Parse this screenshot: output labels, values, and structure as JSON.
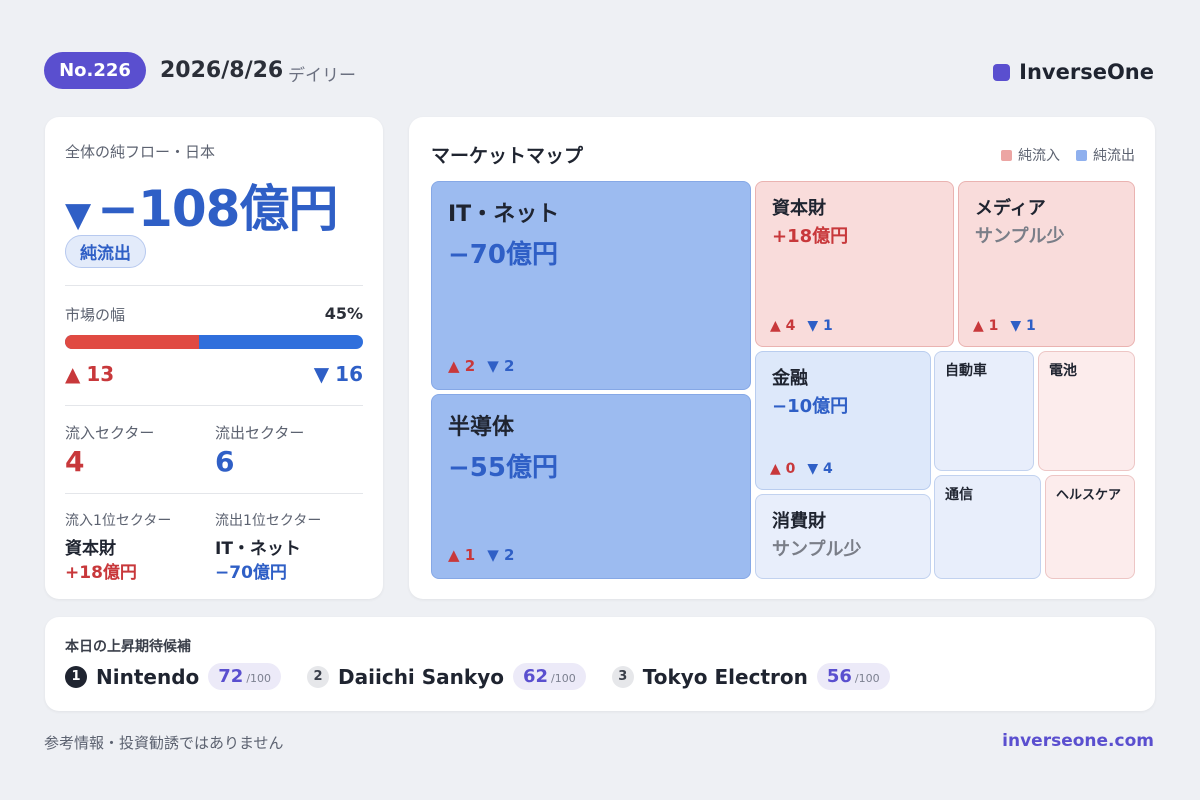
{
  "header": {
    "issue_badge": "No.226",
    "date": "2026/8/26",
    "edition": "デイリー",
    "brand": "InverseOne"
  },
  "summary": {
    "title": "全体の純フロー・日本",
    "flow_arrow": "▼",
    "flow_value": "−108億円",
    "flow_status": "純流出",
    "breadth_label": "市場の幅",
    "breadth_pct": "45%",
    "breadth_fraction": 0.45,
    "up_count": "13",
    "down_count": "16",
    "up_arrow": "▲",
    "down_arrow": "▼",
    "inflow_sectors_label": "流入セクター",
    "inflow_sectors": "4",
    "outflow_sectors_label": "流出セクター",
    "outflow_sectors": "6",
    "top_inflow_label": "流入1位セクター",
    "top_inflow_name": "資本財",
    "top_inflow_value": "+18億円",
    "top_outflow_label": "流出1位セクター",
    "top_outflow_name": "IT・ネット",
    "top_outflow_value": "−70億円"
  },
  "market_map": {
    "title": "マーケットマップ",
    "legend_in": "純流入",
    "legend_out": "純流出",
    "tiles": [
      {
        "name": "IT・ネット",
        "value": "−70億円",
        "up": "▲ 2",
        "down": "▼ 2"
      },
      {
        "name": "半導体",
        "value": "−55億円",
        "up": "▲ 1",
        "down": "▼ 2"
      },
      {
        "name": "資本財",
        "value": "+18億円",
        "up": "▲ 4",
        "down": "▼ 1"
      },
      {
        "name": "メディア",
        "value": "サンプル少",
        "up": "▲ 1",
        "down": "▼ 1"
      },
      {
        "name": "金融",
        "value": "−10億円",
        "up": "▲ 0",
        "down": "▼ 4"
      },
      {
        "name": "消費財",
        "value": "サンプル少"
      },
      {
        "name": "自動車"
      },
      {
        "name": "電池"
      },
      {
        "name": "通信"
      },
      {
        "name": "ヘルスケア"
      }
    ]
  },
  "candidates": {
    "title": "本日の上昇期待候補",
    "items": [
      {
        "rank": "1",
        "name": "Nintendo",
        "score": "72",
        "max": "/100"
      },
      {
        "rank": "2",
        "name": "Daiichi Sankyo",
        "score": "62",
        "max": "/100"
      },
      {
        "rank": "3",
        "name": "Tokyo Electron",
        "score": "56",
        "max": "/100"
      }
    ]
  },
  "footer": {
    "disclaimer": "参考情報・投資勧誘ではありません",
    "url": "inverseone.com"
  },
  "colors": {
    "accent": "#5a4fcf",
    "inflow": "#c8383b",
    "outflow": "#2f5fc6",
    "bar_in": "#e04a42",
    "bar_out": "#2f6fdc"
  }
}
